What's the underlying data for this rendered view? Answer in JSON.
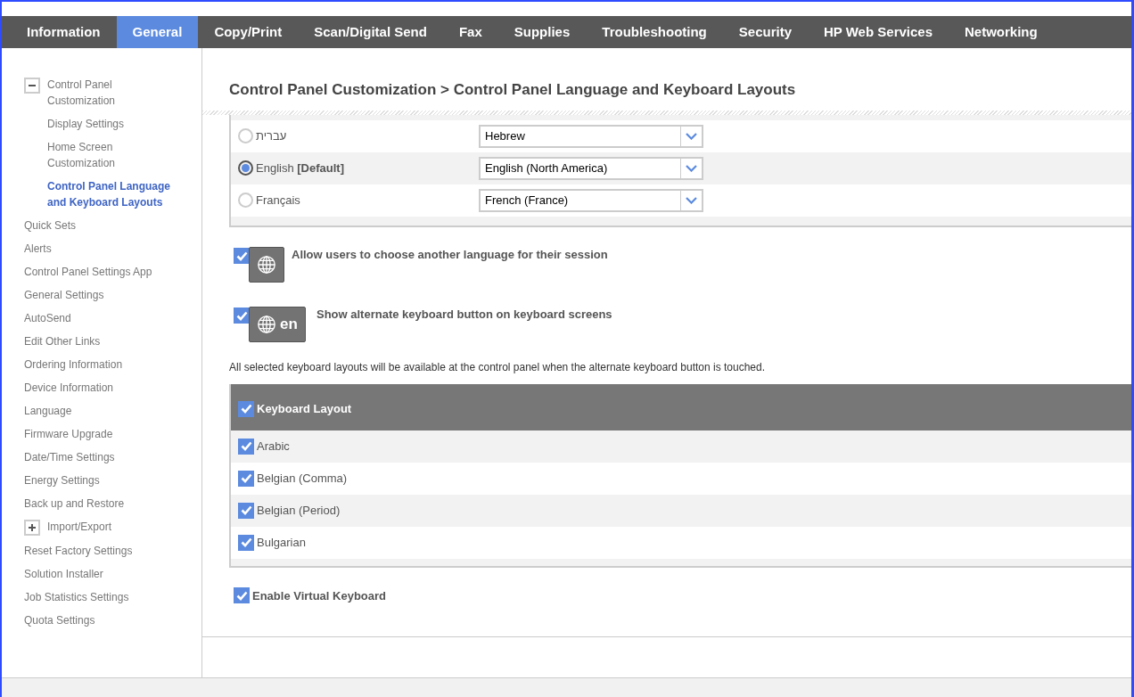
{
  "nav_tabs": [
    {
      "label": "Information",
      "selected": false
    },
    {
      "label": "General",
      "selected": true
    },
    {
      "label": "Copy/Print",
      "selected": false
    },
    {
      "label": "Scan/Digital Send",
      "selected": false
    },
    {
      "label": "Fax",
      "selected": false
    },
    {
      "label": "Supplies",
      "selected": false
    },
    {
      "label": "Troubleshooting",
      "selected": false
    },
    {
      "label": "Security",
      "selected": false
    },
    {
      "label": "HP Web Services",
      "selected": false
    },
    {
      "label": "Networking",
      "selected": false
    }
  ],
  "sidebar": {
    "items": [
      {
        "label": "Control Panel Customization",
        "expanded": true,
        "selected": false,
        "children": [
          {
            "label": "Display Settings",
            "selected": false
          },
          {
            "label": "Home Screen Customization",
            "selected": false
          },
          {
            "label": "Control Panel Language and Keyboard Layouts",
            "selected": true
          }
        ]
      },
      {
        "label": "Quick Sets",
        "selected": false
      },
      {
        "label": "Alerts",
        "selected": false
      },
      {
        "label": "Control Panel Settings App",
        "selected": false
      },
      {
        "label": "General Settings",
        "selected": false
      },
      {
        "label": "AutoSend",
        "selected": false
      },
      {
        "label": "Edit Other Links",
        "selected": false
      },
      {
        "label": "Ordering Information",
        "selected": false
      },
      {
        "label": "Device Information",
        "selected": false
      },
      {
        "label": "Language",
        "selected": false
      },
      {
        "label": "Firmware Upgrade",
        "selected": false
      },
      {
        "label": "Date/Time Settings",
        "selected": false
      },
      {
        "label": "Energy Settings",
        "selected": false
      },
      {
        "label": "Back up and Restore",
        "selected": false
      },
      {
        "label": "Import/Export",
        "expanded": false,
        "selected": false
      },
      {
        "label": "Reset Factory Settings",
        "selected": false
      },
      {
        "label": "Solution Installer",
        "selected": false
      },
      {
        "label": "Job Statistics Settings",
        "selected": false
      },
      {
        "label": "Quota Settings",
        "selected": false
      }
    ]
  },
  "page_title": "Control Panel Customization > Control Panel Language and Keyboard Layouts",
  "languages": [
    {
      "label": "עברית",
      "selected": false,
      "keyboard": "Hebrew"
    },
    {
      "label": "English **[Default]**",
      "selected": true,
      "keyboard": "English (North America)"
    },
    {
      "label": "Français",
      "selected": false,
      "keyboard": "French (France)"
    }
  ],
  "options": [
    {
      "label": "Allow users to choose another language for their session",
      "checked": true
    },
    {
      "label": "Show alternate keyboard button on keyboard screens",
      "checked": true,
      "badge": "en"
    }
  ],
  "keyboard_note": "All selected keyboard layouts will be available at the control panel when the alternate keyboard button is touched.",
  "keyboard_table": {
    "header": "Keyboard Layout",
    "header_checked": true,
    "rows": [
      {
        "label": "Arabic",
        "checked": true
      },
      {
        "label": "Belgian (Comma)",
        "checked": true
      },
      {
        "label": "Belgian (Period)",
        "checked": true
      },
      {
        "label": "Bulgarian",
        "checked": true
      }
    ]
  },
  "virtual_keyboard": {
    "label": "Enable Virtual Keyboard",
    "checked": true
  }
}
